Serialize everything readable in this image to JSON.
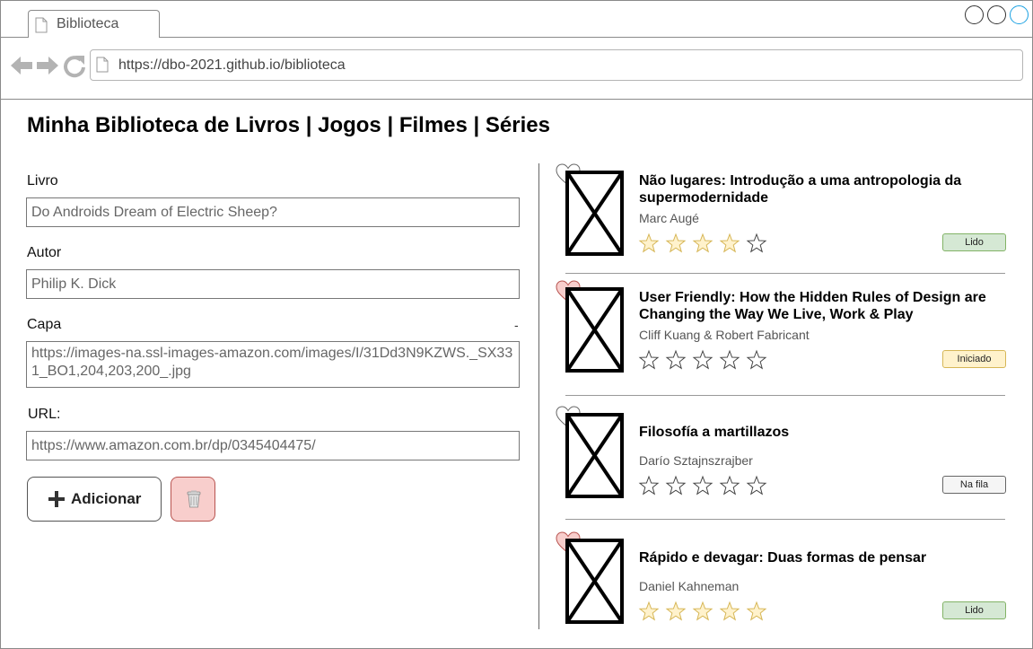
{
  "browser": {
    "tab_title": "Biblioteca",
    "url": "https://dbo-2021.github.io/biblioteca"
  },
  "page": {
    "title": "Minha Biblioteca de Livros | Jogos | Filmes | Séries"
  },
  "form": {
    "book_label": "Livro",
    "book_value": "Do Androids Dream of Electric Sheep?",
    "author_label": "Autor",
    "author_value": "Philip K. Dick",
    "cover_label": "Capa",
    "cover_dash": "-",
    "cover_value": "https://images-na.ssl-images-amazon.com/images/I/31Dd3N9KZWS._SX331_BO1,204,203,200_.jpg",
    "url_label": "URL:",
    "url_value": "https://www.amazon.com.br/dp/0345404475/",
    "add_label": "Adicionar",
    "add_icon": "plus-icon",
    "delete_icon": "trash-icon"
  },
  "colors": {
    "heart_liked": "#f8cecc",
    "heart_plain": "#ffffff",
    "star_filled": "#fff2cc",
    "star_filled_stroke": "#d6b656",
    "status_lido": "#d5e8d4",
    "status_iniciado": "#fff2cc",
    "status_nafila": "#f5f5f5",
    "delete_button": "#f8cecc"
  },
  "books": [
    {
      "title": "Não lugares: Introdução a uma antropologia da supermodernidade",
      "author": "Marc Augé",
      "liked": false,
      "rating": 4,
      "status": "Lido",
      "status_type": "lido"
    },
    {
      "title": "User Friendly: How the Hidden Rules of Design are Changing the Way We Live, Work & Play",
      "author": "Cliff Kuang & Robert Fabricant",
      "liked": true,
      "rating": 0,
      "status": "Iniciado",
      "status_type": "iniciado"
    },
    {
      "title": "Filosofía a martillazos",
      "author": "Darío Sztajnszrajber",
      "liked": false,
      "rating": 0,
      "status": "Na fila",
      "status_type": "nafila"
    },
    {
      "title": "Rápido e devagar: Duas formas de pensar",
      "author": "Daniel Kahneman",
      "liked": true,
      "rating": 5,
      "status": "Lido",
      "status_type": "lido"
    }
  ]
}
